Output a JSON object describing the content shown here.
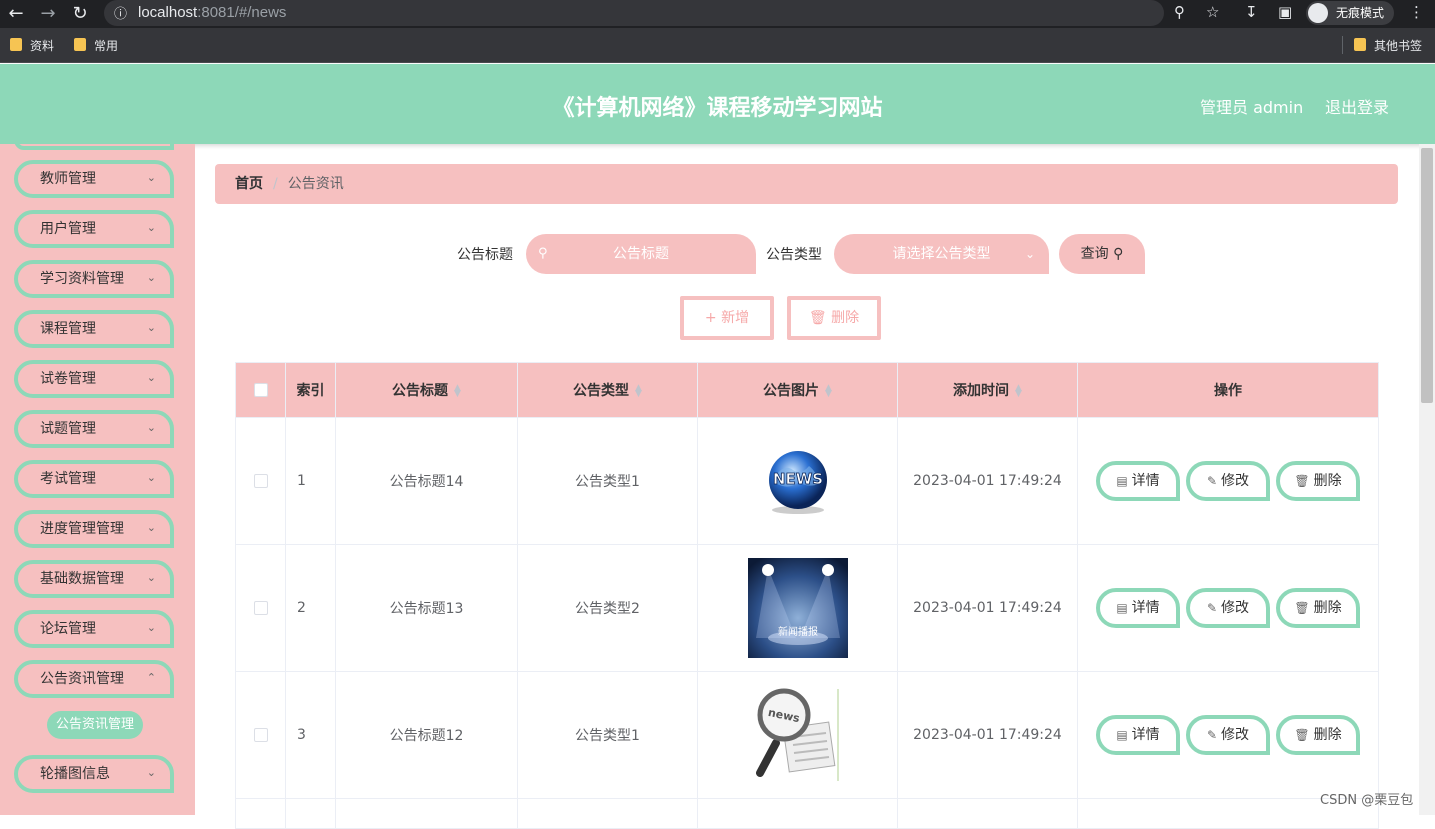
{
  "browser": {
    "url_host": "localhost",
    "url_rest": ":8081/#/news",
    "incognito_label": "无痕模式",
    "bookmarks": [
      "资料",
      "常用"
    ],
    "other_bookmarks": "其他书签"
  },
  "header": {
    "title": "《计算机网络》课程移动学习网站",
    "user": "管理员 admin",
    "logout": "退出登录"
  },
  "sidebar": {
    "items": [
      "教师管理",
      "用户管理",
      "学习资料管理",
      "课程管理",
      "试卷管理",
      "试题管理",
      "考试管理",
      "进度管理管理",
      "基础数据管理",
      "论坛管理",
      "公告资讯管理"
    ],
    "active_sub": "公告资讯管理",
    "last_item": "轮播图信息"
  },
  "breadcrumb": {
    "home": "首页",
    "current": "公告资讯"
  },
  "search": {
    "title_label": "公告标题",
    "title_placeholder": "公告标题",
    "type_label": "公告类型",
    "type_placeholder": "请选择公告类型",
    "query_button": "查询"
  },
  "actions": {
    "add": "新增",
    "delete": "删除"
  },
  "table": {
    "headers": {
      "index": "索引",
      "title": "公告标题",
      "type": "公告类型",
      "image": "公告图片",
      "time": "添加时间",
      "ops": "操作"
    },
    "op_labels": {
      "detail": "详情",
      "edit": "修改",
      "delete": "删除"
    },
    "rows": [
      {
        "index": "1",
        "title": "公告标题14",
        "type": "公告类型1",
        "time": "2023-04-01 17:49:24",
        "image": "news-globe"
      },
      {
        "index": "2",
        "title": "公告标题13",
        "type": "公告类型2",
        "time": "2023-04-01 17:49:24",
        "image": "news-broadcast-stage",
        "image_text": "新闻播报"
      },
      {
        "index": "3",
        "title": "公告标题12",
        "type": "公告类型1",
        "time": "2023-04-01 17:49:24",
        "image": "news-magnifier"
      }
    ]
  },
  "watermark": "CSDN @栗豆包",
  "colors": {
    "header": "#8dd8b8",
    "accent_pink": "#f6c0c0",
    "accent_green": "#8dd8b8"
  }
}
